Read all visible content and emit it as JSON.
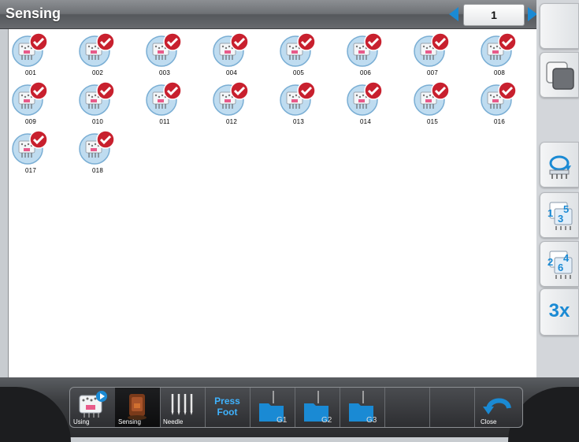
{
  "header": {
    "title": "Sensing",
    "page_number": "1"
  },
  "tiles": [
    {
      "label": "001"
    },
    {
      "label": "002"
    },
    {
      "label": "003"
    },
    {
      "label": "004"
    },
    {
      "label": "005"
    },
    {
      "label": "006"
    },
    {
      "label": "007"
    },
    {
      "label": "008"
    },
    {
      "label": "009"
    },
    {
      "label": "010"
    },
    {
      "label": "011"
    },
    {
      "label": "012"
    },
    {
      "label": "013"
    },
    {
      "label": "014"
    },
    {
      "label": "015"
    },
    {
      "label": "016"
    },
    {
      "label": "017"
    },
    {
      "label": "018"
    }
  ],
  "right_panel": {
    "buttons": [
      {
        "name": "blank-button",
        "icon": ""
      },
      {
        "name": "copy-layers-button",
        "icon": "layers-icon"
      },
      {
        "name": "rotate-sensor-button",
        "icon": "rotate-arrow-icon"
      },
      {
        "name": "sequence-135-button",
        "icon": "sequence-135-icon",
        "text": [
          "1",
          "5",
          "3"
        ]
      },
      {
        "name": "sequence-246-button",
        "icon": "sequence-246-icon",
        "text": [
          "2",
          "4",
          "6"
        ]
      },
      {
        "name": "repeat-3x-button",
        "icon": "",
        "text": [
          "3x"
        ]
      }
    ]
  },
  "toolbar": {
    "using_label": "Using",
    "sensing_label": "Sensing",
    "needle_label": "Needle",
    "press_foot_line1": "Press",
    "press_foot_line2": "Foot",
    "g1_label": "G1",
    "g2_label": "G2",
    "g3_label": "G3",
    "close_label": "Close"
  },
  "colors": {
    "tile_bg": "#bfdcf0",
    "check_badge": "#c8202e",
    "accent_blue": "#1a8ad4"
  }
}
